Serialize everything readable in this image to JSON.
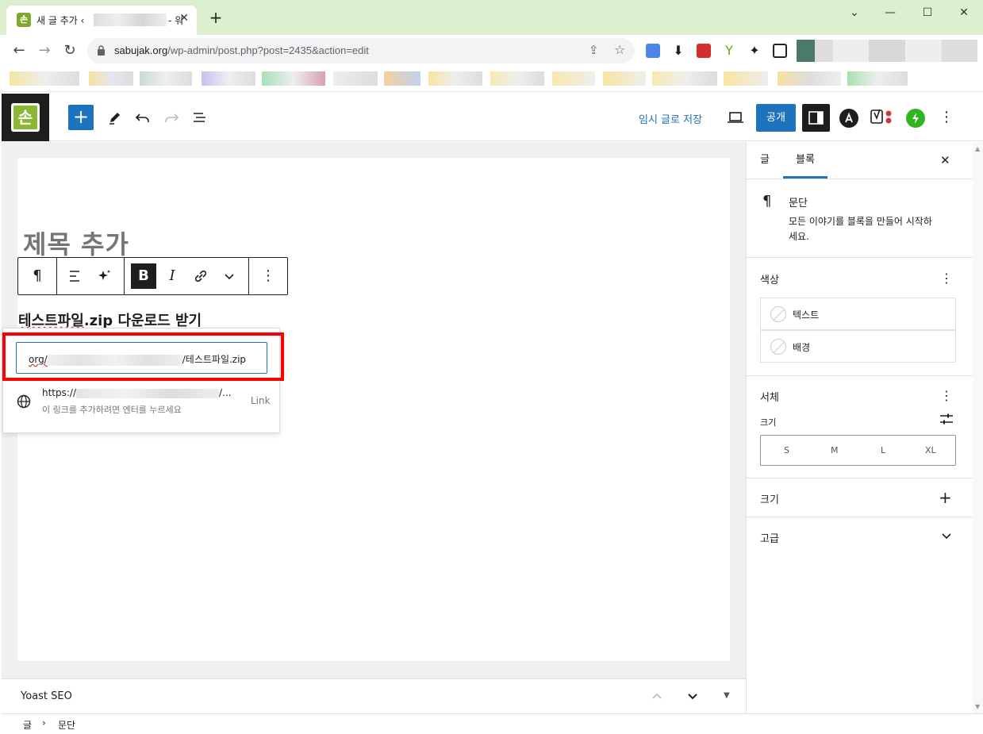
{
  "browser": {
    "tab_title": "새 글 추가 ‹",
    "tab_suffix": "- 워",
    "url_host": "sabujak.org",
    "url_path": "/wp-admin/post.php?post=2435&action=edit"
  },
  "editor": {
    "save_draft": "임시 글로 저장",
    "publish": "공개",
    "site_logo": "손",
    "title_placeholder": "제목 추가",
    "paragraph_text": "테스트파일.zip 다운로드 받기",
    "paragraph_underlined": "테스트파일",
    "paragraph_rest": ".zip 다운로드 받기"
  },
  "link_popover": {
    "input_prefix": "org/",
    "input_suffix": "/테스트파일.zip",
    "suggestion_url_prefix": "https://",
    "suggestion_url_suffix": "/...",
    "suggestion_hint": "이 링크를 추가하려면 엔터를 누르세요",
    "suggestion_type": "Link"
  },
  "sidebar": {
    "tabs": [
      "글",
      "블록"
    ],
    "active_tab": "블록",
    "block_name": "문단",
    "block_description_line1": "모든 이야기를 블록을 만들어 시작하",
    "block_description_line2": "세요.",
    "color_section": "색상",
    "colors": [
      "텍스트",
      "배경"
    ],
    "typography_section": "서체",
    "size_label": "크기",
    "sizes": [
      "S",
      "M",
      "L",
      "XL"
    ],
    "dimensions_section": "크기",
    "advanced_section": "고급"
  },
  "footer": {
    "yoast_label": "Yoast SEO",
    "breadcrumb": [
      "글",
      "문단"
    ]
  }
}
